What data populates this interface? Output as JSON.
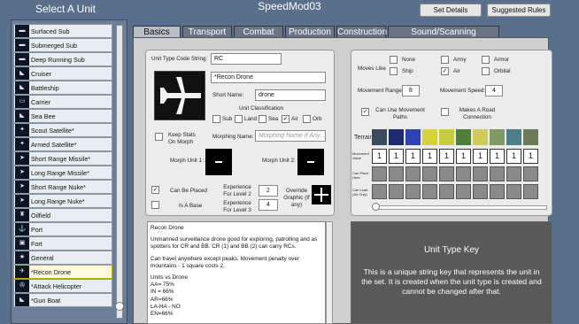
{
  "app": {
    "title": "SpeedMod03",
    "set_details": "Set Details",
    "suggested_rules": "Suggested Rules"
  },
  "left": {
    "title": "Select A Unit",
    "units": [
      {
        "label": "Surfaced Sub",
        "icon": "submarine-icon"
      },
      {
        "label": "Submerged Sub",
        "icon": "submarine-icon"
      },
      {
        "label": "Deep Running Sub",
        "icon": "submarine-icon"
      },
      {
        "label": "Cruiser",
        "icon": "ship-icon"
      },
      {
        "label": "Battleship",
        "icon": "ship-icon"
      },
      {
        "label": "Carrier",
        "icon": "carrier-icon"
      },
      {
        "label": "Sea Bee",
        "icon": "ship-icon"
      },
      {
        "label": "Scout Satellite*",
        "icon": "satellite-icon"
      },
      {
        "label": "Armed Satellite*",
        "icon": "satellite-icon"
      },
      {
        "label": "Short Range Missile*",
        "icon": "missile-icon"
      },
      {
        "label": "Long Range Missile*",
        "icon": "missile-icon"
      },
      {
        "label": "Short Range Nuke*",
        "icon": "missile-icon"
      },
      {
        "label": "Long Range Nuke*",
        "icon": "missile-icon"
      },
      {
        "label": "Oilfield",
        "icon": "oilfield-icon"
      },
      {
        "label": "Port",
        "icon": "port-icon"
      },
      {
        "label": "Fort",
        "icon": "fort-icon"
      },
      {
        "label": "General",
        "icon": "general-icon"
      },
      {
        "label": "*Recon Drone",
        "icon": "drone-icon",
        "selected": true
      },
      {
        "label": "*Attack Helicopter",
        "icon": "helicopter-icon"
      },
      {
        "label": "*Gun Boat",
        "icon": "ship-icon"
      }
    ]
  },
  "tabs": [
    "Basics",
    "Transport",
    "Combat",
    "Production",
    "Construction",
    "Sound/Scanning"
  ],
  "basics": {
    "code_label": "Unit Type Code String:",
    "code_value": "RC",
    "name_value": "*Recon Drone",
    "short_name_label": "Short Name:",
    "short_name_value": "drone",
    "classification_label": "Unit Classification",
    "classes": [
      {
        "label": "Sub",
        "checked": false
      },
      {
        "label": "Land",
        "checked": false
      },
      {
        "label": "Sea",
        "checked": false
      },
      {
        "label": "Air",
        "checked": true
      },
      {
        "label": "Orb",
        "checked": false
      }
    ],
    "keep_stats": "Keep Stats On Morph",
    "morphing_name_label": "Morphing Name:",
    "morphing_name_placeholder": "Morphing Name If Any...",
    "morph1": "Morph Unit 1 :",
    "morph2": "Morph Unit 2:",
    "can_be_placed": "Can Be Placed",
    "is_a_base": "Is A Base",
    "exp2_label": "Experience For Level 2",
    "exp2_value": "2",
    "exp3_label": "Experience For Level 3",
    "exp3_value": "4",
    "override_graphic": "Override Graphic (If any)"
  },
  "movement": {
    "moves_like": "Moves Like",
    "options": [
      {
        "label": "None",
        "checked": false
      },
      {
        "label": "Army",
        "checked": false
      },
      {
        "label": "Armor",
        "checked": false
      },
      {
        "label": "Ship",
        "checked": false
      },
      {
        "label": "Air",
        "checked": true
      },
      {
        "label": "Orbital",
        "checked": false
      }
    ],
    "range_label": "Movement Range:",
    "range_value": "8",
    "speed_label": "Movement Speed:",
    "speed_value": "4",
    "can_use_paths": "Can Use Movement Paths",
    "road_connection": "Makes A Road Connection",
    "terrain_label": "Terrain",
    "movement_value_label": "Movement Value",
    "can_place_label": "Can Place Here",
    "can_load_label": "Can Load (Air Only)",
    "values": [
      "1",
      "1",
      "1",
      "1",
      "1",
      "1",
      "1",
      "1",
      "1",
      "1"
    ]
  },
  "description": {
    "paragraphs": [
      "Recon Drone",
      "Unmanned surveillance drone good for exploring, patrolling and as spotters for CR and BB. CR (1) and BB (2) can carry RCs.",
      "Can travel anywhere except peaks. Movement penalty over mountains - 1 square costs 2."
    ],
    "stats": [
      "Units vs Drone",
      "AA= 75%",
      "IN = 66%",
      "AR=66%",
      "LA-HA - NO",
      "EN=66%"
    ]
  },
  "key": {
    "title": "Unit Type Key",
    "text": "This is a unique string key that represents the unit in the set. It is created when the unit type is created and cannot be changed after that."
  },
  "colors": {
    "background": "#5a6f8c",
    "selected_unit": "#fffbe3",
    "key_panel": "#595959"
  }
}
